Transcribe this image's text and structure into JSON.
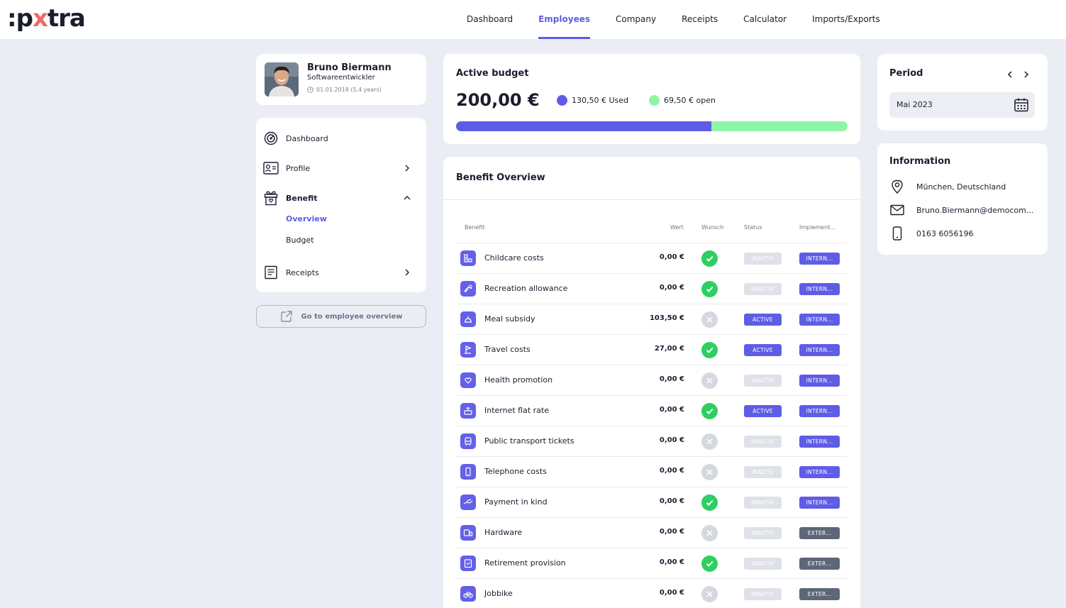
{
  "brand": {
    "logo_prefix": ":p",
    "logo_x": "x",
    "logo_suffix": "tra"
  },
  "nav": {
    "items": [
      "Dashboard",
      "Employees",
      "Company",
      "Receipts",
      "Calculator",
      "Imports/Exports"
    ],
    "active": "Employees"
  },
  "profile": {
    "name": "Bruno Biermann",
    "role": "Softwareentwickler",
    "since": "01.01.2018 (5,4 years)"
  },
  "menu": {
    "dashboard": "Dashboard",
    "profile": "Profile",
    "benefit": "Benefit",
    "overview": "Overview",
    "budget": "Budget",
    "receipts": "Receipts"
  },
  "employee_overview_button": "Go to employee overview",
  "budget": {
    "title": "Active budget",
    "total": "200,00 €",
    "used_label": "130,50 € Used",
    "open_label": "69,50 € open",
    "used_fraction": 0.6525,
    "used_color": "#5f5ce6",
    "open_color": "#8ff5a6"
  },
  "overview": {
    "title": "Benefit Overview",
    "columns": {
      "benefit": "Benefit",
      "value": "Wert",
      "wish": "Wunsch",
      "status": "Status",
      "impl": "Implement..."
    },
    "rows": [
      {
        "name": "Childcare costs",
        "value": "0,00 €",
        "wish": true,
        "status": "INAKTIV",
        "impl": "INTERN..."
      },
      {
        "name": "Recreation allowance",
        "value": "0,00 €",
        "wish": true,
        "status": "INAKTIV",
        "impl": "INTERN..."
      },
      {
        "name": "Meal subsidy",
        "value": "103,50 €",
        "wish": false,
        "status": "ACTIVE",
        "impl": "INTERN..."
      },
      {
        "name": "Travel costs",
        "value": "27,00 €",
        "wish": true,
        "status": "ACTIVE",
        "impl": "INTERN..."
      },
      {
        "name": "Health promotion",
        "value": "0,00 €",
        "wish": false,
        "status": "INAKTIV",
        "impl": "INTERN..."
      },
      {
        "name": "Internet flat rate",
        "value": "0,00 €",
        "wish": true,
        "status": "ACTIVE",
        "impl": "INTERN..."
      },
      {
        "name": "Public transport tickets",
        "value": "0,00 €",
        "wish": false,
        "status": "INAKTIV",
        "impl": "INTERN..."
      },
      {
        "name": "Telephone costs",
        "value": "0,00 €",
        "wish": false,
        "status": "INAKTIV",
        "impl": "INTERN..."
      },
      {
        "name": "Payment in kind",
        "value": "0,00 €",
        "wish": true,
        "status": "INAKTIV",
        "impl": "INTERN..."
      },
      {
        "name": "Hardware",
        "value": "0,00 €",
        "wish": false,
        "status": "INAKTIV",
        "impl": "EXTER..."
      },
      {
        "name": "Retirement provision",
        "value": "0,00 €",
        "wish": true,
        "status": "INAKTIV",
        "impl": "EXTER..."
      },
      {
        "name": "Jobbike",
        "value": "0,00 €",
        "wish": false,
        "status": "INAKTIV",
        "impl": "EXTER..."
      }
    ]
  },
  "period": {
    "title": "Period",
    "value": "Mai 2023"
  },
  "info": {
    "title": "Information",
    "location": "München, Deutschland",
    "email": "Bruno.Biermann@democom...",
    "phone": "0163 6056196"
  }
}
